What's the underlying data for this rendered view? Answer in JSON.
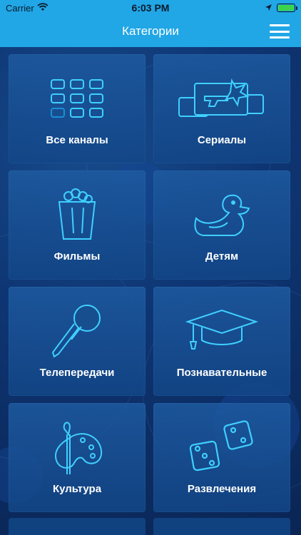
{
  "status_bar": {
    "carrier": "Carrier",
    "time": "6:03 PM",
    "wifi_icon": "wifi-icon",
    "location_icon": "location-arrow-icon",
    "battery_icon": "battery-icon",
    "battery_color": "#3bd34b"
  },
  "nav": {
    "title": "Категории",
    "menu_icon": "hamburger-menu-icon",
    "bar_color": "#21a6e6"
  },
  "categories": [
    {
      "label": "Все каналы",
      "icon": "channel-grid-icon"
    },
    {
      "label": "Сериалы",
      "icon": "tv-series-gun-icon"
    },
    {
      "label": "Фильмы",
      "icon": "popcorn-icon"
    },
    {
      "label": "Детям",
      "icon": "rubber-duck-icon"
    },
    {
      "label": "Телепередачи",
      "icon": "microphone-icon"
    },
    {
      "label": "Познавательные",
      "icon": "graduation-cap-icon"
    },
    {
      "label": "Культура",
      "icon": "paint-palette-icon"
    },
    {
      "label": "Развлечения",
      "icon": "dice-icon"
    }
  ],
  "colors": {
    "icon_glow": "#3fd0ff",
    "tile_bg": "#1a5a9e",
    "page_bg": "#0c2f63"
  }
}
